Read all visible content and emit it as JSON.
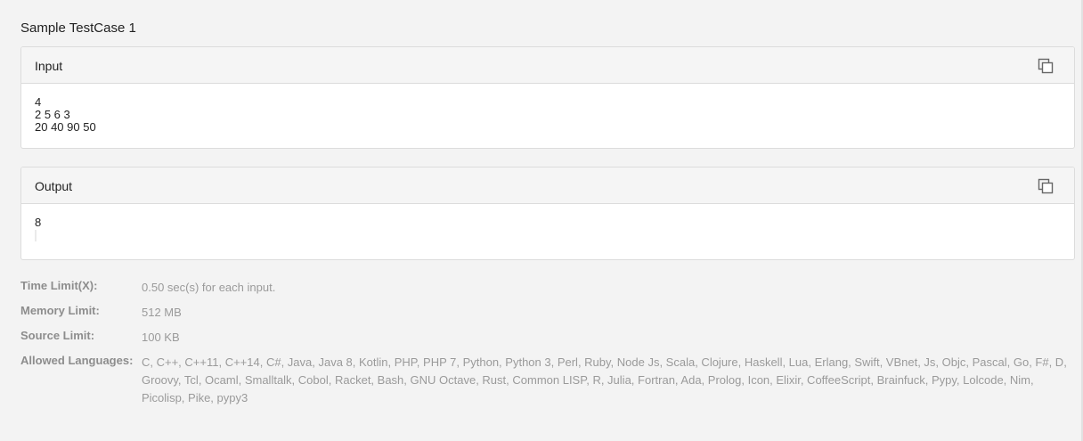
{
  "testcase": {
    "title": "Sample TestCase 1",
    "input": {
      "label": "Input",
      "content": "4\n2 5 6 3\n20 40 90 50",
      "copy_icon": "copy-icon"
    },
    "output": {
      "label": "Output",
      "content": "8",
      "copy_icon": "copy-icon"
    }
  },
  "limits": {
    "time": {
      "label": "Time Limit(X):",
      "value": "0.50 sec(s) for each input."
    },
    "memory": {
      "label": "Memory Limit:",
      "value": "512 MB"
    },
    "source": {
      "label": "Source Limit:",
      "value": "100 KB"
    },
    "languages": {
      "label": "Allowed Languages:",
      "value": "C, C++, C++11, C++14, C#, Java, Java 8, Kotlin, PHP, PHP 7, Python, Python 3, Perl, Ruby, Node Js, Scala, Clojure, Haskell, Lua, Erlang, Swift, VBnet, Js, Objc, Pascal, Go, F#, D, Groovy, Tcl, Ocaml, Smalltalk, Cobol, Racket, Bash, GNU Octave, Rust, Common LISP, R, Julia, Fortran, Ada, Prolog, Icon, Elixir, CoffeeScript, Brainfuck, Pypy, Lolcode, Nim, Picolisp, Pike, pypy3"
    }
  },
  "colors": {
    "background": "#f3f3f3",
    "panel_header": "#f5f5f5",
    "border": "#dcdcdc",
    "muted_text": "#9a9a9a"
  }
}
